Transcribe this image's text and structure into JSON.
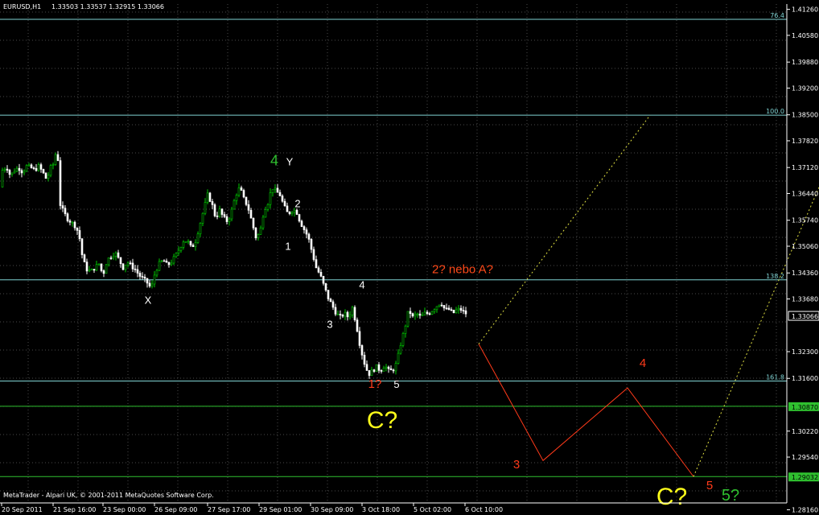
{
  "header": {
    "symbol": "EURUSD,H1",
    "ohlc": "1.33503 1.33537 1.32915 1.33066"
  },
  "footer": "MetaTrader - Alpari UK, © 2001-2011 MetaQuotes Software Corp.",
  "colors": {
    "background": "#000000",
    "grid": "#4a4a4a",
    "fib": "#7fd3d3",
    "green_level": "#2fc02f",
    "bull": "#00c800",
    "bear": "#ffffff",
    "projection": "#ff3a1a",
    "dotted": "#e0e040"
  },
  "chart_data": {
    "type": "candlestick",
    "symbol": "EURUSD",
    "timeframe": "H1",
    "ylim": [
      1.2834,
      1.414
    ],
    "y_ticks": [
      "1.41260",
      "1.40580",
      "1.39880",
      "1.39200",
      "1.38500",
      "1.37820",
      "1.37120",
      "1.36440",
      "1.35740",
      "1.35060",
      "1.34360",
      "1.33680",
      "1.32300",
      "1.31600",
      "1.30220",
      "1.29540",
      "1.28160"
    ],
    "x_ticks": [
      "20 Sep 2011",
      "21 Sep 16:00",
      "23 Sep 00:00",
      "26 Sep 09:00",
      "27 Sep 17:00",
      "29 Sep 01:00",
      "30 Sep 09:00",
      "3 Oct 18:00",
      "5 Oct 02:00",
      "6 Oct 10:00"
    ],
    "current_price": "1.33066",
    "levels": [
      {
        "name": "76.4",
        "price": 1.41,
        "label": "76.4",
        "kind": "fib"
      },
      {
        "name": "100.0",
        "price": 1.3849,
        "label": "100.0",
        "kind": "fib"
      },
      {
        "name": "138.2",
        "price": 1.3418,
        "label": "138.2",
        "kind": "fib"
      },
      {
        "name": "161.8",
        "price": 1.3153,
        "label": "161.8",
        "kind": "fib"
      },
      {
        "name": "h1",
        "price": 1.3087,
        "label": "1.30870",
        "kind": "horizontal"
      },
      {
        "name": "h2",
        "price": 1.2903,
        "label": "1.29032",
        "kind": "horizontal"
      }
    ],
    "price_path": [
      [
        0,
        1.3661
      ],
      [
        5,
        1.3705
      ],
      [
        10,
        1.3715
      ],
      [
        15,
        1.369
      ],
      [
        20,
        1.3705
      ],
      [
        25,
        1.3712
      ],
      [
        30,
        1.37
      ],
      [
        35,
        1.3715
      ],
      [
        40,
        1.3712
      ],
      [
        45,
        1.3705
      ],
      [
        50,
        1.3715
      ],
      [
        55,
        1.37
      ],
      [
        60,
        1.368
      ],
      [
        65,
        1.3712
      ],
      [
        70,
        1.3725
      ],
      [
        73,
        1.379
      ],
      [
        76,
        1.362
      ],
      [
        80,
        1.36
      ],
      [
        85,
        1.358
      ],
      [
        90,
        1.357
      ],
      [
        95,
        1.356
      ],
      [
        100,
        1.354
      ],
      [
        105,
        1.347
      ],
      [
        110,
        1.3445
      ],
      [
        115,
        1.344
      ],
      [
        120,
        1.345
      ],
      [
        125,
        1.346
      ],
      [
        130,
        1.343
      ],
      [
        135,
        1.347
      ],
      [
        140,
        1.348
      ],
      [
        145,
        1.349
      ],
      [
        150,
        1.347
      ],
      [
        155,
        1.345
      ],
      [
        160,
        1.3465
      ],
      [
        165,
        1.3455
      ],
      [
        170,
        1.3445
      ],
      [
        175,
        1.343
      ],
      [
        180,
        1.342
      ],
      [
        185,
        1.341
      ],
      [
        190,
        1.3395
      ],
      [
        195,
        1.344
      ],
      [
        200,
        1.346
      ],
      [
        205,
        1.347
      ],
      [
        210,
        1.3455
      ],
      [
        215,
        1.3465
      ],
      [
        220,
        1.348
      ],
      [
        225,
        1.35
      ],
      [
        230,
        1.352
      ],
      [
        235,
        1.352
      ],
      [
        240,
        1.35
      ],
      [
        245,
        1.352
      ],
      [
        250,
        1.356
      ],
      [
        255,
        1.36
      ],
      [
        260,
        1.364
      ],
      [
        265,
        1.362
      ],
      [
        270,
        1.358
      ],
      [
        275,
        1.36
      ],
      [
        280,
        1.358
      ],
      [
        285,
        1.357
      ],
      [
        290,
        1.36
      ],
      [
        295,
        1.364
      ],
      [
        300,
        1.366
      ],
      [
        305,
        1.363
      ],
      [
        310,
        1.361
      ],
      [
        315,
        1.357
      ],
      [
        320,
        1.353
      ],
      [
        325,
        1.354
      ],
      [
        330,
        1.36
      ],
      [
        335,
        1.362
      ],
      [
        340,
        1.366
      ],
      [
        345,
        1.365
      ],
      [
        350,
        1.364
      ],
      [
        355,
        1.361
      ],
      [
        360,
        1.359
      ],
      [
        365,
        1.36
      ],
      [
        370,
        1.36
      ],
      [
        375,
        1.357
      ],
      [
        380,
        1.355
      ],
      [
        385,
        1.353
      ],
      [
        390,
        1.349
      ],
      [
        395,
        1.345
      ],
      [
        400,
        1.343
      ],
      [
        405,
        1.34
      ],
      [
        410,
        1.337
      ],
      [
        415,
        1.335
      ],
      [
        420,
        1.333
      ],
      [
        425,
        1.332
      ],
      [
        430,
        1.333
      ],
      [
        435,
        1.332
      ],
      [
        440,
        1.3345
      ],
      [
        445,
        1.33
      ],
      [
        450,
        1.324
      ],
      [
        455,
        1.32
      ],
      [
        460,
        1.317
      ],
      [
        465,
        1.318
      ],
      [
        470,
        1.319
      ],
      [
        475,
        1.318
      ],
      [
        480,
        1.3195
      ],
      [
        485,
        1.318
      ],
      [
        490,
        1.318
      ],
      [
        495,
        1.32
      ],
      [
        500,
        1.325
      ],
      [
        505,
        1.329
      ],
      [
        510,
        1.334
      ],
      [
        515,
        1.332
      ],
      [
        520,
        1.333
      ],
      [
        525,
        1.332
      ],
      [
        530,
        1.333
      ],
      [
        535,
        1.333
      ],
      [
        540,
        1.334
      ],
      [
        545,
        1.335
      ],
      [
        550,
        1.336
      ],
      [
        555,
        1.334
      ],
      [
        560,
        1.334
      ],
      [
        565,
        1.333
      ],
      [
        570,
        1.334
      ],
      [
        575,
        1.334
      ],
      [
        580,
        1.333
      ]
    ],
    "projection_path": [
      [
        595,
        1.325
      ],
      [
        675,
        1.2945
      ],
      [
        780,
        1.3135
      ],
      [
        862,
        1.2903
      ]
    ],
    "dotted_paths": [
      [
        [
          595,
          1.325
        ],
        [
          808,
          1.3849
        ]
      ],
      [
        [
          862,
          1.2903
        ],
        [
          1018,
          1.366
        ]
      ]
    ],
    "annotations": [
      {
        "text": "4",
        "x": 341,
        "price": 1.3718,
        "color": "#2fc02f",
        "size": 18
      },
      {
        "text": "Y",
        "x": 360,
        "price": 1.3718,
        "color": "#ffffff",
        "size": 13
      },
      {
        "text": "2",
        "x": 370,
        "price": 1.3608,
        "color": "#ffffff",
        "size": 13
      },
      {
        "text": "1",
        "x": 358,
        "price": 1.3496,
        "color": "#ffffff",
        "size": 13
      },
      {
        "text": "X",
        "x": 184,
        "price": 1.3355,
        "color": "#ffffff",
        "size": 13
      },
      {
        "text": "4",
        "x": 450,
        "price": 1.3395,
        "color": "#ffffff",
        "size": 13
      },
      {
        "text": "3",
        "x": 410,
        "price": 1.3292,
        "color": "#ffffff",
        "size": 13
      },
      {
        "text": "2? nebo  A?",
        "x": 575,
        "price": 1.3435,
        "color": "#ff4a1a",
        "size": 15
      },
      {
        "text": "1?",
        "x": 466,
        "price": 1.3135,
        "color": "#ff3a1a",
        "size": 15
      },
      {
        "text": "5",
        "x": 493,
        "price": 1.3135,
        "color": "#ffffff",
        "size": 13
      },
      {
        "text": "C?",
        "x": 475,
        "price": 1.303,
        "color": "#ffff1a",
        "size": 30
      },
      {
        "text": "4",
        "x": 799,
        "price": 1.319,
        "color": "#ff3a1a",
        "size": 15
      },
      {
        "text": "3",
        "x": 642,
        "price": 1.2925,
        "color": "#ff3a1a",
        "size": 15
      },
      {
        "text": "5",
        "x": 882,
        "price": 1.287,
        "color": "#ff3a1a",
        "size": 15
      },
      {
        "text": "C?",
        "x": 835,
        "price": 1.283,
        "color": "#ffff1a",
        "size": 30
      },
      {
        "text": "5?",
        "x": 908,
        "price": 1.284,
        "color": "#2fc02f",
        "size": 20
      }
    ]
  }
}
